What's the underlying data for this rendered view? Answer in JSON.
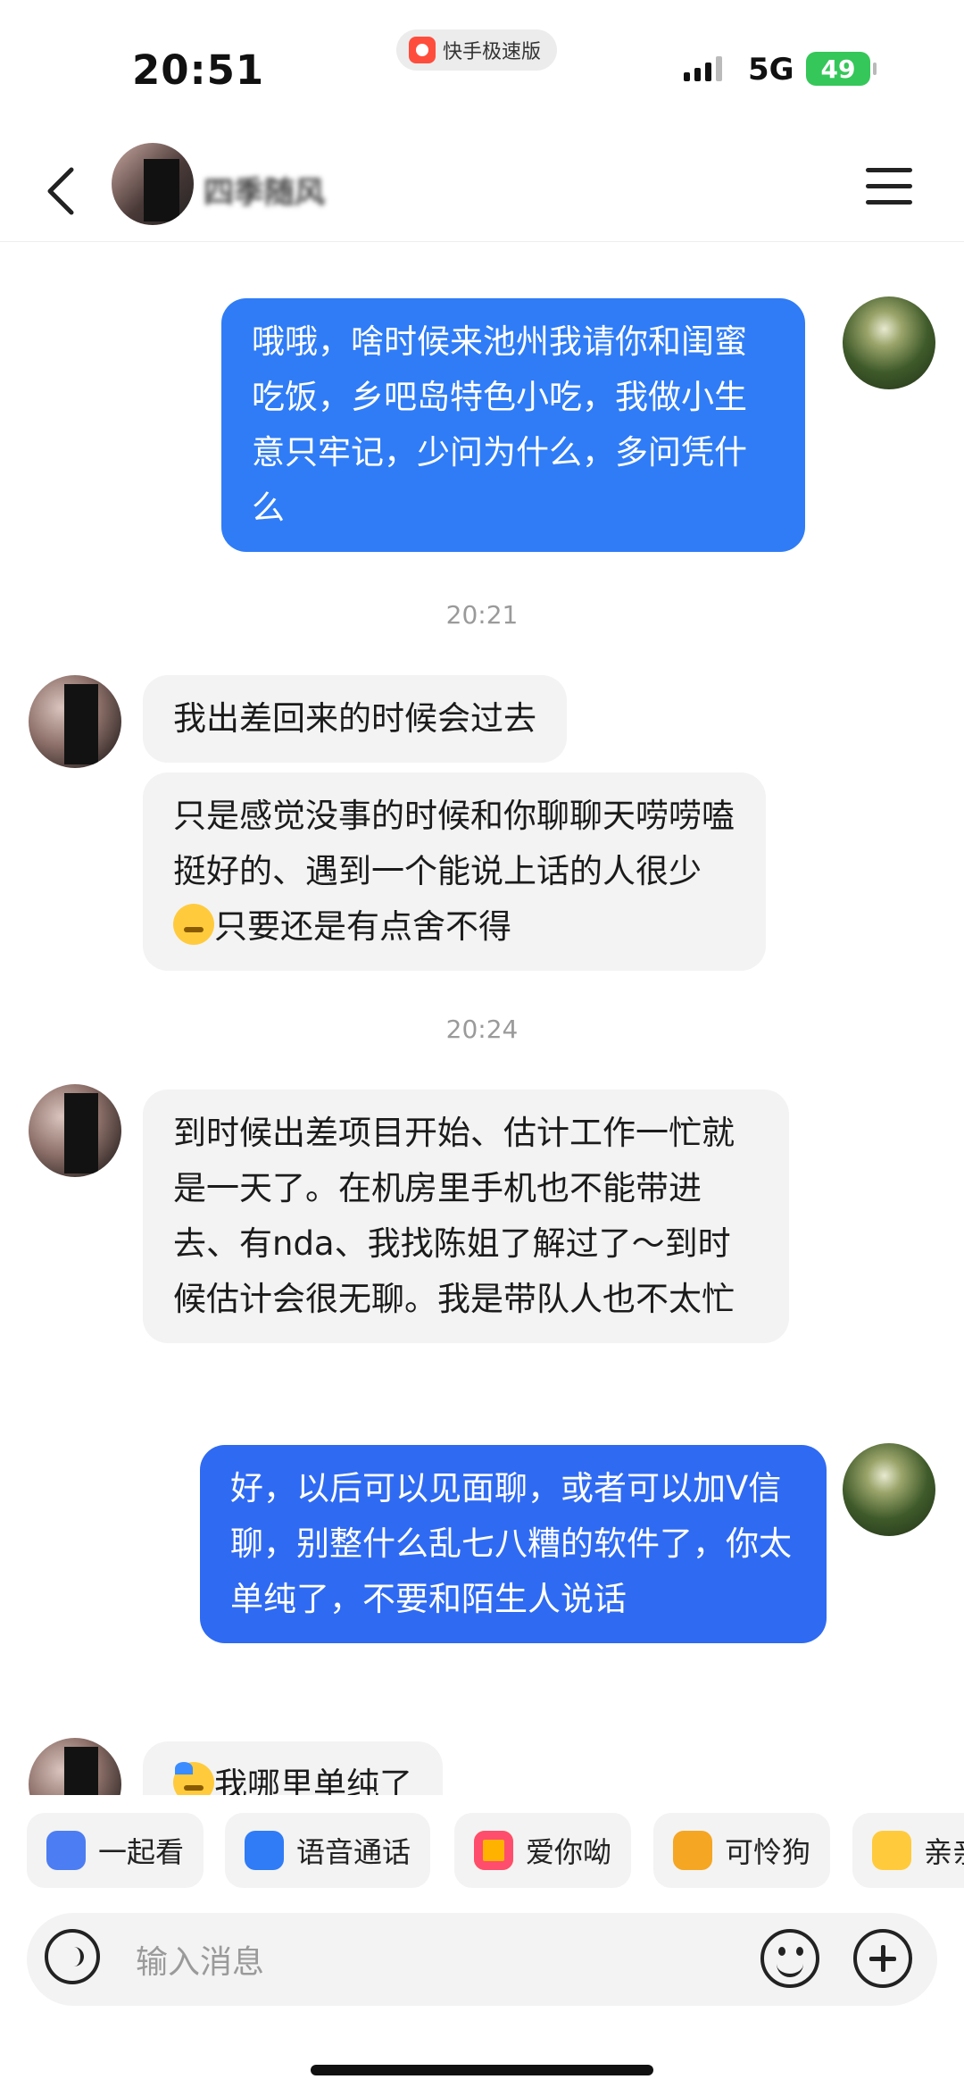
{
  "status_bar": {
    "time": "20:51",
    "app_badge": "快手极速版",
    "network": "5G",
    "battery": "49"
  },
  "header": {
    "contact_name": "四季随风"
  },
  "messages": [
    {
      "side": "out",
      "text": "哦哦，啥时候来池州我请你和闺蜜吃饭，乡吧岛特色小吃，我做小生意只牢记，少问为什么，多问凭什么"
    },
    {
      "timestamp": "20:21"
    },
    {
      "side": "in",
      "text": "我出差回来的时候会过去"
    },
    {
      "side": "in",
      "text_before": "只是感觉没事的时候和你聊聊天唠唠嗑挺好的、遇到一个能说上话的人很少",
      "emoji": "shush-emoji",
      "text_after": "只要还是有点舍不得"
    },
    {
      "timestamp": "20:24"
    },
    {
      "side": "in",
      "text": "到时候出差项目开始、估计工作一忙就是一天了。在机房里手机也不能带进去、有nda、我找陈姐了解过了～到时候估计会很无聊。我是带队人也不太忙"
    },
    {
      "side": "out",
      "text": "好，以后可以见面聊，或者可以加V信聊，别整什么乱七八糟的软件了，你太单纯了，不要和陌生人说话"
    },
    {
      "side": "in",
      "emoji": "sweat-emoji",
      "text": "我哪里单纯了"
    }
  ],
  "quick_actions": [
    {
      "label": "一起看",
      "icon": "watch-together-icon"
    },
    {
      "label": "语音通话",
      "icon": "phone-icon"
    },
    {
      "label": "爱你呦",
      "icon": "love-emoji-icon"
    },
    {
      "label": "可怜狗",
      "icon": "dog-emoji-icon"
    },
    {
      "label": "亲亲",
      "icon": "hug-emoji-icon"
    }
  ],
  "input": {
    "placeholder": "输入消息"
  },
  "colors": {
    "outgoing_bubble": "#2f7cf6",
    "incoming_bubble": "#f3f3f3",
    "battery": "#35c759"
  }
}
